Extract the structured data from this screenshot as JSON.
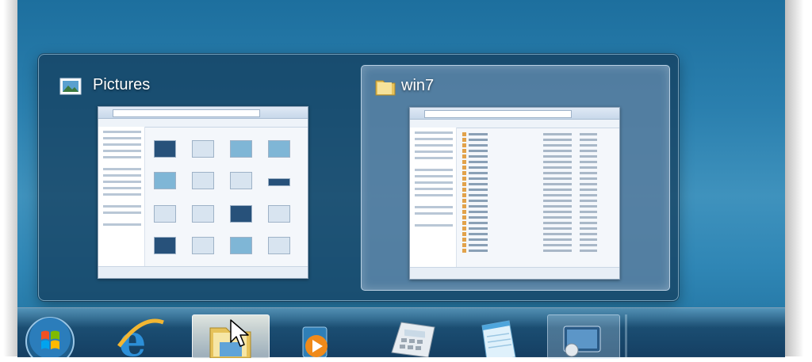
{
  "peek": {
    "windows": [
      {
        "title": "Pictures",
        "icon": "pictures-library-icon",
        "selected": false
      },
      {
        "title": "win7",
        "icon": "folder-icon",
        "selected": true
      }
    ]
  },
  "taskbar": {
    "items": [
      {
        "icon": "windows-start-orb-icon",
        "state": "normal"
      },
      {
        "icon": "internet-explorer-icon",
        "state": "normal"
      },
      {
        "icon": "windows-explorer-icon",
        "state": "active"
      },
      {
        "icon": "windows-media-player-icon",
        "state": "normal"
      },
      {
        "icon": "calculator-icon",
        "state": "normal"
      },
      {
        "icon": "notepad-icon",
        "state": "normal"
      },
      {
        "icon": "remote-desktop-icon",
        "state": "running"
      }
    ]
  },
  "cursor": {
    "icon": "mouse-pointer-icon"
  },
  "colors": {
    "accent": "#2a7fae",
    "selection": "#82a5c8"
  }
}
